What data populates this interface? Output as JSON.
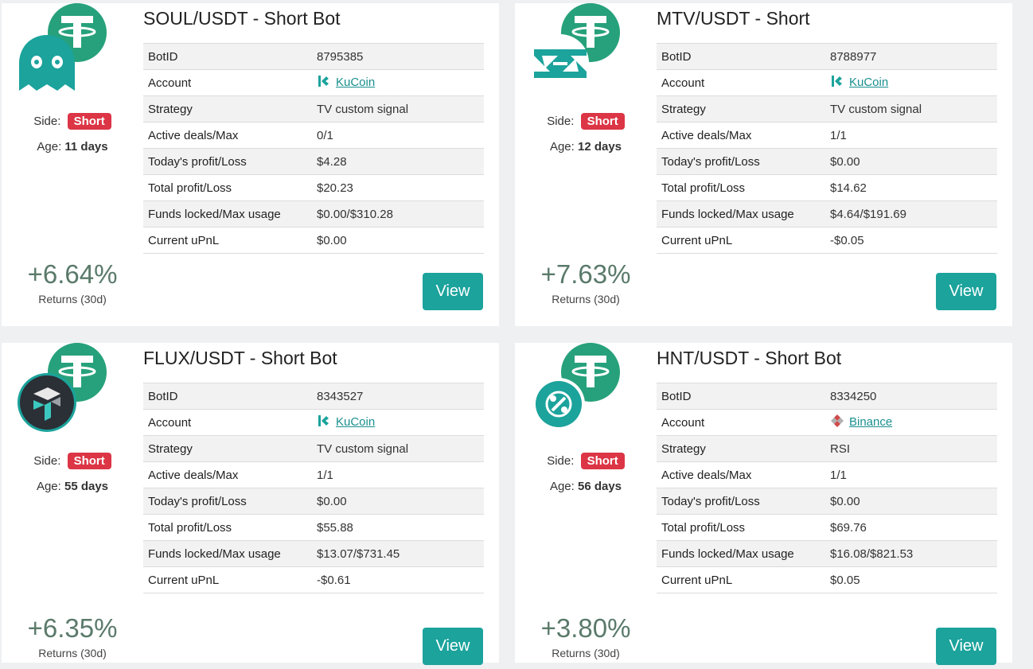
{
  "labels": {
    "side": "Side:",
    "age": "Age:",
    "returns": "Returns (30d)",
    "view": "View",
    "rows": [
      "BotID",
      "Account",
      "Strategy",
      "Active deals/Max",
      "Today's profit/Loss",
      "Total profit/Loss",
      "Funds locked/Max usage",
      "Current uPnL"
    ]
  },
  "colors": {
    "accent": "#1ba39c",
    "short_badge": "#dc3545",
    "usdt": "#26a17b",
    "returns": "#5a7a6a"
  },
  "bots": [
    {
      "title": "SOUL/USDT - Short Bot",
      "coin_icon": "soul-icon",
      "side": "Short",
      "age": "11 days",
      "returns": "+6.64%",
      "bot_id": "8795385",
      "account": "KuCoin",
      "account_icon": "kucoin-icon",
      "strategy": "TV custom signal",
      "active_deals": "0/1",
      "today_pl": "$4.28",
      "total_pl": "$20.23",
      "funds": "$0.00/$310.28",
      "upnl": "$0.00"
    },
    {
      "title": "MTV/USDT - Short",
      "coin_icon": "mtv-icon",
      "side": "Short",
      "age": "12 days",
      "returns": "+7.63%",
      "bot_id": "8788977",
      "account": "KuCoin",
      "account_icon": "kucoin-icon",
      "strategy": "TV custom signal",
      "active_deals": "1/1",
      "today_pl": "$0.00",
      "total_pl": "$14.62",
      "funds": "$4.64/$191.69",
      "upnl": "-$0.05"
    },
    {
      "title": "FLUX/USDT - Short Bot",
      "coin_icon": "flux-icon",
      "side": "Short",
      "age": "55 days",
      "returns": "+6.35%",
      "bot_id": "8343527",
      "account": "KuCoin",
      "account_icon": "kucoin-icon",
      "strategy": "TV custom signal",
      "active_deals": "1/1",
      "today_pl": "$0.00",
      "total_pl": "$55.88",
      "funds": "$13.07/$731.45",
      "upnl": "-$0.61"
    },
    {
      "title": "HNT/USDT - Short Bot",
      "coin_icon": "hnt-icon",
      "side": "Short",
      "age": "56 days",
      "returns": "+3.80%",
      "bot_id": "8334250",
      "account": "Binance",
      "account_icon": "binance-icon",
      "strategy": "RSI",
      "active_deals": "1/1",
      "today_pl": "$0.00",
      "total_pl": "$69.76",
      "funds": "$16.08/$821.53",
      "upnl": "$0.05"
    }
  ]
}
